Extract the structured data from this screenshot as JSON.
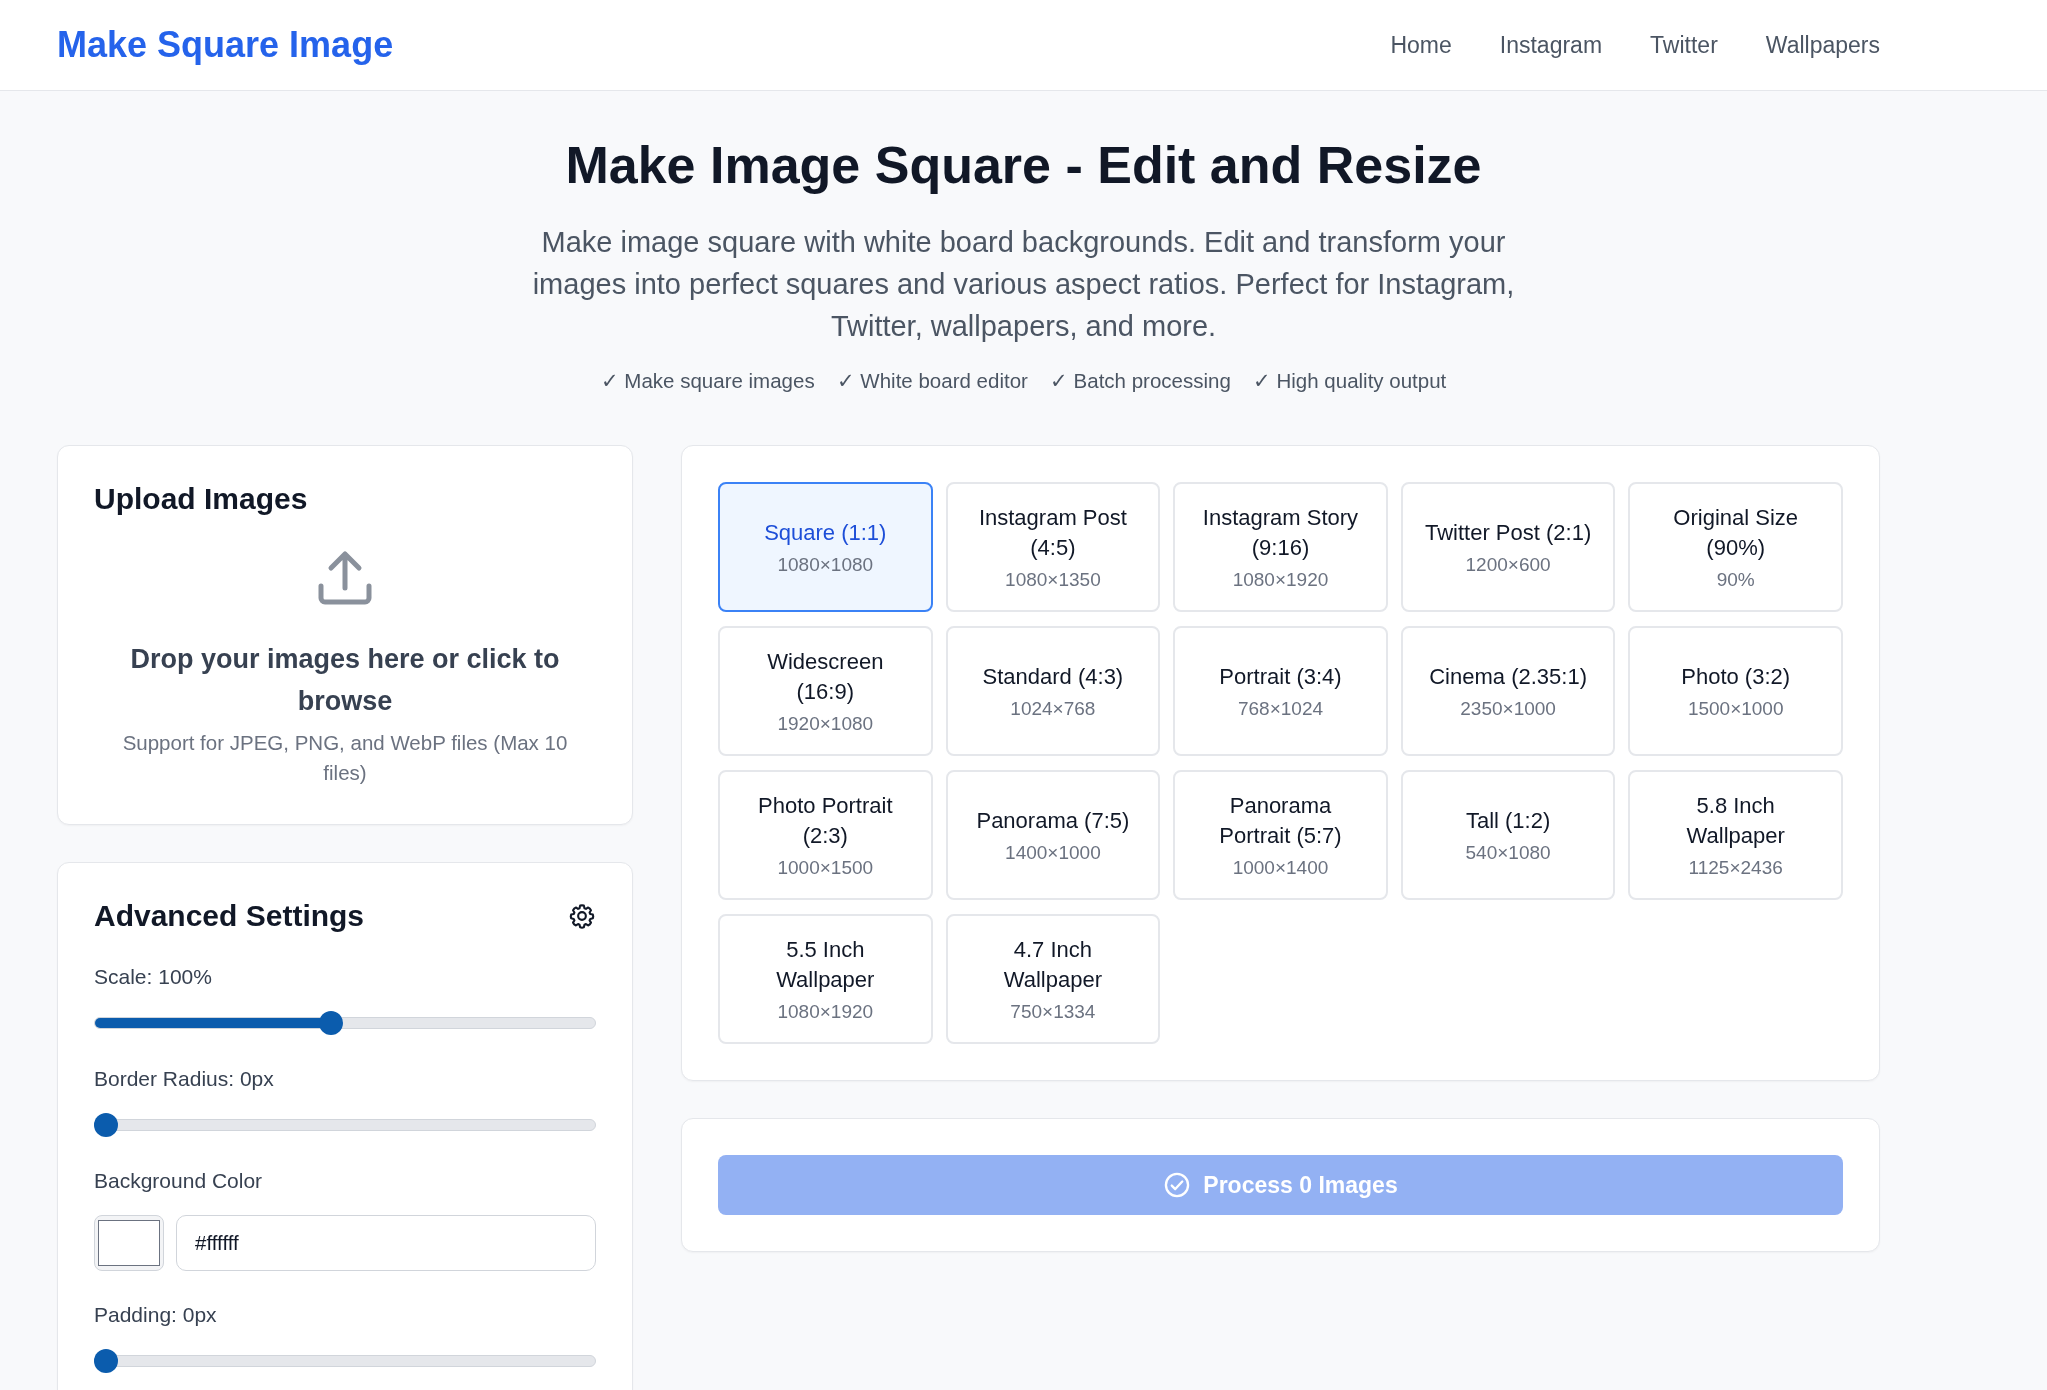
{
  "header": {
    "logo": "Make Square Image",
    "nav": [
      "Home",
      "Instagram",
      "Twitter",
      "Wallpapers"
    ]
  },
  "hero": {
    "title": "Make Image Square - Edit and Resize",
    "subtitle": "Make image square with white board backgrounds. Edit and transform your images into perfect squares and various aspect ratios. Perfect for Instagram, Twitter, wallpapers, and more.",
    "features": [
      "✓ Make square images",
      "✓ White board editor",
      "✓ Batch processing",
      "✓ High quality output"
    ]
  },
  "upload": {
    "title": "Upload Images",
    "drop_text": "Drop your images here or click to browse",
    "support_text": "Support for JPEG, PNG, and WebP files (Max 10 files)"
  },
  "settings": {
    "title": "Advanced Settings",
    "controls": [
      {
        "kind": "slider",
        "label": "Scale: 100%",
        "level": 0.47
      },
      {
        "kind": "slider",
        "label": "Border Radius: 0px",
        "level": 0
      },
      {
        "kind": "color",
        "label": "Background Color",
        "color": "#ffffff",
        "value": "#ffffff"
      },
      {
        "kind": "slider",
        "label": "Padding: 0px",
        "level": 0
      }
    ]
  },
  "presets": [
    {
      "name": "Square (1:1)",
      "size": "1080×1080",
      "selected": true
    },
    {
      "name": "Instagram Post (4:5)",
      "size": "1080×1350",
      "selected": false
    },
    {
      "name": "Instagram Story (9:16)",
      "size": "1080×1920",
      "selected": false
    },
    {
      "name": "Twitter Post (2:1)",
      "size": "1200×600",
      "selected": false
    },
    {
      "name": "Original Size (90%)",
      "size": "90%",
      "selected": false
    },
    {
      "name": "Widescreen (16:9)",
      "size": "1920×1080",
      "selected": false
    },
    {
      "name": "Standard (4:3)",
      "size": "1024×768",
      "selected": false
    },
    {
      "name": "Portrait (3:4)",
      "size": "768×1024",
      "selected": false
    },
    {
      "name": "Cinema (2.35:1)",
      "size": "2350×1000",
      "selected": false
    },
    {
      "name": "Photo (3:2)",
      "size": "1500×1000",
      "selected": false
    },
    {
      "name": "Photo Portrait (2:3)",
      "size": "1000×1500",
      "selected": false
    },
    {
      "name": "Panorama (7:5)",
      "size": "1400×1000",
      "selected": false
    },
    {
      "name": "Panorama Portrait (5:7)",
      "size": "1000×1400",
      "selected": false
    },
    {
      "name": "Tall (1:2)",
      "size": "540×1080",
      "selected": false
    },
    {
      "name": "5.8 Inch Wallpaper",
      "size": "1125×2436",
      "selected": false
    },
    {
      "name": "5.5 Inch Wallpaper",
      "size": "1080×1920",
      "selected": false
    },
    {
      "name": "4.7 Inch Wallpaper",
      "size": "750×1334",
      "selected": false
    }
  ],
  "process_button": {
    "label": "Process 0 Images",
    "disabled": true
  }
}
